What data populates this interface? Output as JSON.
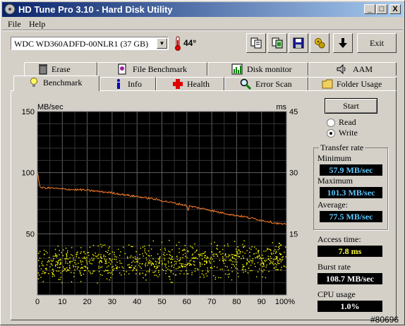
{
  "window": {
    "title": "HD Tune Pro 3.10 - Hard Disk Utility"
  },
  "titlebar_buttons": {
    "minimize": "_",
    "maximize": "□",
    "close": "X"
  },
  "menu": {
    "file": "File",
    "help": "Help"
  },
  "toolbar": {
    "drive": "WDC WD360ADFD-00NLR1 (37 GB)",
    "temperature": "44°",
    "buttons": [
      "copy-text-icon",
      "copy-screenshot-icon",
      "save-icon",
      "options-icon",
      "down-arrow-icon"
    ],
    "exit_label": "Exit"
  },
  "tabs": {
    "top": [
      {
        "label": "Erase",
        "icon": "trash-icon"
      },
      {
        "label": "File Benchmark",
        "icon": "file-benchmark-icon"
      },
      {
        "label": "Disk monitor",
        "icon": "disk-monitor-icon"
      },
      {
        "label": "AAM",
        "icon": "speaker-icon"
      }
    ],
    "bottom": [
      {
        "label": "Benchmark",
        "icon": "lightbulb-icon",
        "active": true
      },
      {
        "label": "Info",
        "icon": "info-icon"
      },
      {
        "label": "Health",
        "icon": "health-cross-icon"
      },
      {
        "label": "Error Scan",
        "icon": "magnifier-icon"
      },
      {
        "label": "Folder Usage",
        "icon": "folder-icon"
      }
    ]
  },
  "benchmark": {
    "start_label": "Start",
    "mode_options": [
      "Read",
      "Write"
    ],
    "mode_selected": "Write",
    "transfer_rate_title": "Transfer rate",
    "minimum_label": "Minimum",
    "minimum_value": "57.9 MB/sec",
    "maximum_label": "Maximum",
    "maximum_value": "101.3 MB/sec",
    "average_label": "Average:",
    "average_value": "77.5 MB/sec",
    "access_time_label": "Access time:",
    "access_time_value": "7.8 ms",
    "burst_rate_label": "Burst rate",
    "burst_rate_value": "108.7 MB/sec",
    "cpu_usage_label": "CPU usage",
    "cpu_usage_value": "1.0%"
  },
  "watermark": "#80696",
  "colors": {
    "transfer_line": "#ff7f27",
    "access_dots": "#ffff00",
    "plot_bg": "#000000",
    "grid": "#606060"
  },
  "chart_data": {
    "type": "line",
    "ylabel_left": "MB/sec",
    "ylabel_right": "ms",
    "ylim_left": [
      0,
      150
    ],
    "ylim_right": [
      0,
      45
    ],
    "yticks_left": [
      "150",
      "100",
      "50"
    ],
    "yticks_right": [
      "45",
      "30",
      "15"
    ],
    "xlim": [
      0,
      100
    ],
    "xticks": [
      "0",
      "10",
      "20",
      "30",
      "40",
      "50",
      "60",
      "70",
      "80",
      "90",
      "100%"
    ],
    "grid": true,
    "series": [
      {
        "kind": "line",
        "x": [
          0,
          1,
          3,
          5,
          8,
          10,
          12,
          15,
          18,
          20,
          23,
          25,
          28,
          30,
          33,
          35,
          38,
          40,
          43,
          45,
          48,
          50,
          53,
          55,
          58,
          60,
          60.5,
          61,
          63,
          65,
          68,
          70,
          73,
          75,
          78,
          80,
          83,
          85,
          88,
          90,
          93,
          95,
          98,
          100
        ],
        "y": [
          101,
          88,
          87.5,
          87.5,
          87,
          86.5,
          86.5,
          86,
          86,
          85.5,
          85,
          84.5,
          84,
          83.5,
          82.5,
          82,
          81,
          80.5,
          79.5,
          79,
          78,
          77,
          76,
          75,
          74,
          73,
          69,
          72.5,
          72,
          71,
          70,
          69,
          67.5,
          67,
          65.5,
          65,
          64,
          63,
          62,
          61,
          60,
          59,
          58,
          57.5
        ]
      },
      {
        "kind": "scatter",
        "description_range_ms": [
          2,
          14
        ],
        "y_center_ms": 7.8
      }
    ]
  }
}
